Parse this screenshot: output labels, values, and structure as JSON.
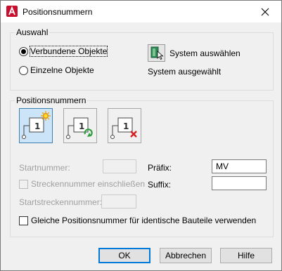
{
  "window": {
    "title": "Positionsnummern"
  },
  "auswahl": {
    "legend": "Auswahl",
    "radio_connected": {
      "label": "Verbundene Objekte",
      "checked": true
    },
    "radio_single": {
      "label": "Einzelne Objekte",
      "checked": false
    },
    "select_system_label": "System auswählen",
    "status_text": "System ausgewählt"
  },
  "positionsnummern": {
    "legend": "Positionsnummern",
    "mode_buttons": [
      {
        "icon": "balloon-add-icon",
        "active": true
      },
      {
        "icon": "balloon-renumber-icon",
        "active": false
      },
      {
        "icon": "balloon-delete-icon",
        "active": false
      }
    ],
    "startnummer_label": "Startnummer:",
    "startnummer_value": "",
    "strecken_checkbox_label": "Streckennummer einschließen",
    "strecken_checked": false,
    "startstrecken_label": "Startstreckennummer:",
    "startstrecken_value": "",
    "praefix_label": "Präfix:",
    "praefix_value": "MV",
    "suffix_label": "Suffix:",
    "suffix_value": ""
  },
  "identical_checkbox": {
    "label": "Gleiche Positionsnummer für identische Bauteile verwenden",
    "checked": false
  },
  "buttons": {
    "ok": "OK",
    "cancel": "Abbrechen",
    "help": "Hilfe"
  },
  "colors": {
    "accent": "#0078d7",
    "active_button_bg": "#cce4f7",
    "app_icon_red": "#c8102e"
  }
}
